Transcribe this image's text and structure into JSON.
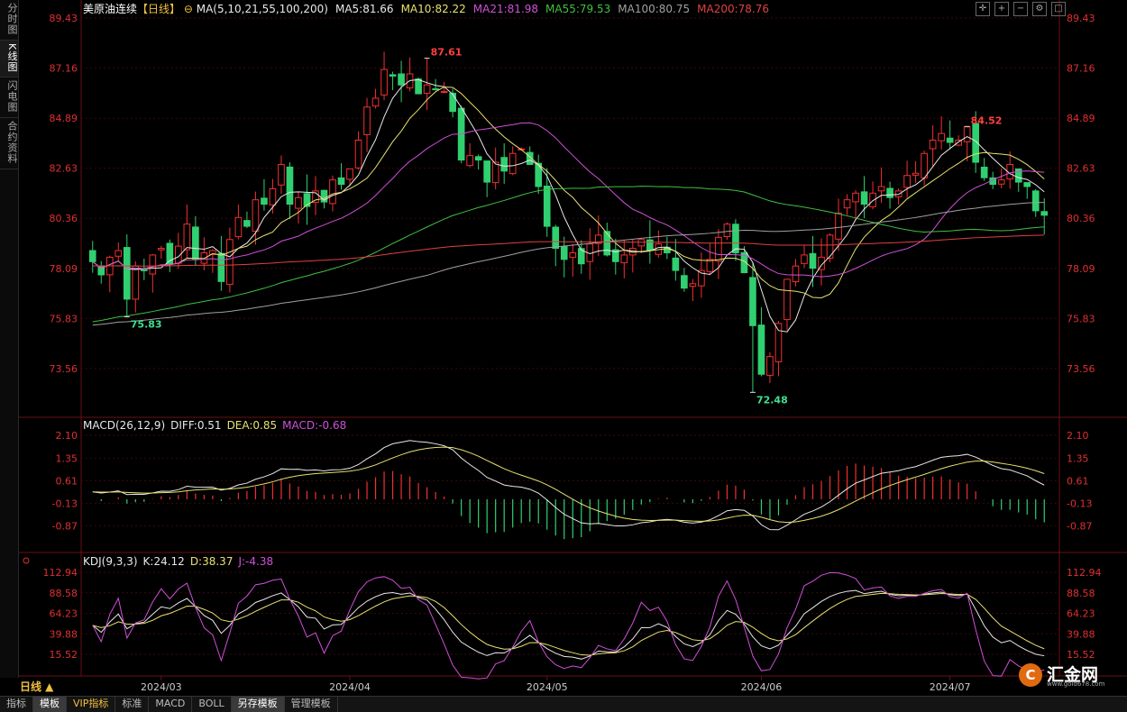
{
  "sidebar": [
    {
      "label": "分时图",
      "active": false
    },
    {
      "label": "K线图",
      "active": true
    },
    {
      "label": "闪电图",
      "active": false
    },
    {
      "label": "合约资料",
      "active": false
    }
  ],
  "main_header": {
    "name": "美原油连续",
    "period": "【日线】",
    "ma_params": "MA(5,10,21,55,100,200)",
    "items": [
      {
        "text": "MA5:81.66",
        "color": "#e8e8e8"
      },
      {
        "text": "MA10:82.22",
        "color": "#e8e070"
      },
      {
        "text": "MA21:81.98",
        "color": "#d050d8"
      },
      {
        "text": "MA55:79.53",
        "color": "#40c040"
      },
      {
        "text": "MA100:80.75",
        "color": "#a0a0a0"
      },
      {
        "text": "MA200:78.76",
        "color": "#e04040"
      }
    ]
  },
  "macd_header": {
    "title": "MACD(26,12,9)",
    "items": [
      {
        "text": "DIFF:0.51",
        "color": "#e8e8e8"
      },
      {
        "text": "DEA:0.85",
        "color": "#e8e070"
      },
      {
        "text": "MACD:-0.68",
        "color": "#d050d8"
      }
    ]
  },
  "kdj_header": {
    "title": "KDJ(9,3,3)",
    "items": [
      {
        "text": "K:24.12",
        "color": "#e8e8e8"
      },
      {
        "text": "D:38.37",
        "color": "#e8e070"
      },
      {
        "text": "J:-4.38",
        "color": "#d050d8"
      }
    ]
  },
  "period_label": "日线 ▲",
  "bottom_tabs": [
    {
      "label": "指标",
      "style": ""
    },
    {
      "label": "模板",
      "style": "active"
    },
    {
      "label": "VIP指标",
      "style": "vip"
    },
    {
      "label": "标准",
      "style": ""
    },
    {
      "label": "MACD",
      "style": ""
    },
    {
      "label": "BOLL",
      "style": ""
    },
    {
      "label": "另存模板",
      "style": "active"
    },
    {
      "label": "管理模板",
      "style": ""
    }
  ],
  "logo": {
    "name": "汇金网",
    "url": "www.gold678.com"
  },
  "colors": {
    "up": "#f03030",
    "down": "#30d070",
    "grid": "#3a0a0a",
    "axis": "#e03030"
  },
  "chart_data": {
    "type": "candlestick",
    "symbol": "美原油连续",
    "price_axis": {
      "ticks": [
        73.56,
        75.83,
        78.09,
        80.36,
        82.63,
        84.89,
        87.16,
        89.43
      ],
      "range": [
        71.8,
        89.43
      ]
    },
    "macd_axis": {
      "ticks": [
        -0.87,
        -0.13,
        0.61,
        1.35,
        2.1
      ],
      "range": [
        -1.45,
        2.1
      ]
    },
    "kdj_axis": {
      "ticks": [
        15.52,
        39.88,
        64.23,
        88.58,
        112.94
      ],
      "range": [
        -8,
        112.94
      ]
    },
    "x_labels": [
      {
        "label": "2024/03",
        "bar": 8
      },
      {
        "label": "2024/04",
        "bar": 30
      },
      {
        "label": "2024/05",
        "bar": 53
      },
      {
        "label": "2024/06",
        "bar": 78
      },
      {
        "label": "2024/07",
        "bar": 100
      }
    ],
    "annotations": [
      {
        "text": "87.61",
        "bar": 39,
        "price": 87.61,
        "type": "high"
      },
      {
        "text": "75.83",
        "bar": 4,
        "price": 75.9,
        "type": "low"
      },
      {
        "text": "72.48",
        "bar": 77,
        "price": 72.48,
        "type": "low"
      },
      {
        "text": "84.52",
        "bar": 102,
        "price": 84.52,
        "type": "high"
      }
    ],
    "closes": [
      78.4,
      77.8,
      78.6,
      78.9,
      76.7,
      78.2,
      78.0,
      78.7,
      79.0,
      78.3,
      79.1,
      80.1,
      78.5,
      78.8,
      78.9,
      77.5,
      79.4,
      80.4,
      80.0,
      81.2,
      81.0,
      81.7,
      82.8,
      81.0,
      81.3,
      80.9,
      81.6,
      81.1,
      82.1,
      81.9,
      82.6,
      83.9,
      85.4,
      85.8,
      87.1,
      86.8,
      86.4,
      86.9,
      86.0,
      86.4,
      86.2,
      86.1,
      85.2,
      83.0,
      83.2,
      83.0,
      82.0,
      82.9,
      82.5,
      83.3,
      83.5,
      82.8,
      81.8,
      80.0,
      79.0,
      78.5,
      78.8,
      78.3,
      79.2,
      79.6,
      78.7,
      78.4,
      78.7,
      79.0,
      79.4,
      78.9,
      79.2,
      78.8,
      78.0,
      77.2,
      77.4,
      78.0,
      78.5,
      79.5,
      80.1,
      78.8,
      77.9,
      75.5,
      73.3,
      74.1,
      75.6,
      77.6,
      78.2,
      78.7,
      78.1,
      78.6,
      79.6,
      80.6,
      81.2,
      81.5,
      81.0,
      81.5,
      81.8,
      81.3,
      81.6,
      82.3,
      82.4,
      83.3,
      83.9,
      84.2,
      83.8,
      83.9,
      84.5,
      82.9,
      82.2,
      81.9,
      82.1,
      82.8,
      82.0,
      81.8,
      80.7,
      80.5
    ],
    "macd_diff_range": [
      -1.0,
      1.93
    ],
    "kdj_k_last": 24.12,
    "kdj_d_last": 38.37,
    "kdj_j_last": -4.38
  }
}
